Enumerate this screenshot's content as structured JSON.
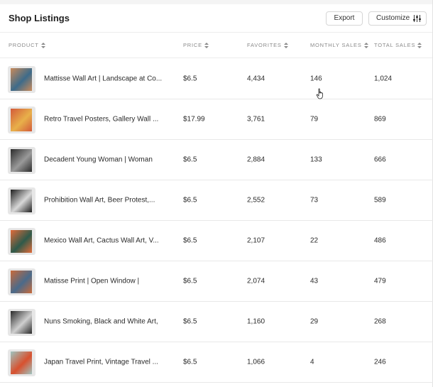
{
  "header": {
    "title": "Shop Listings",
    "export_label": "Export",
    "customize_label": "Customize"
  },
  "columns": {
    "product": "PRODUCT",
    "price": "PRICE",
    "favorites": "FAVORITES",
    "monthly_sales": "MONTHLY SALES",
    "total_sales": "TOTAL SALES"
  },
  "rows": [
    {
      "name": "Mattisse Wall Art | Landscape at Co...",
      "price": "$6.5",
      "favorites": "4,434",
      "monthly_sales": "146",
      "total_sales": "1,024",
      "thumb_color": "#c98a5a",
      "thumb_accent": "#3d6b8a"
    },
    {
      "name": "Retro Travel Posters, Gallery Wall ...",
      "price": "$17.99",
      "favorites": "3,761",
      "monthly_sales": "79",
      "total_sales": "869",
      "thumb_color": "#d35a3a",
      "thumb_accent": "#e8b04a"
    },
    {
      "name": "Decadent Young Woman | Woman",
      "price": "$6.5",
      "favorites": "2,884",
      "monthly_sales": "133",
      "total_sales": "666",
      "thumb_color": "#2b2b2b",
      "thumb_accent": "#9a9a9a"
    },
    {
      "name": "Prohibition Wall Art, Beer Protest,...",
      "price": "$6.5",
      "favorites": "2,552",
      "monthly_sales": "73",
      "total_sales": "589",
      "thumb_color": "#1f1f1f",
      "thumb_accent": "#d8d8d8"
    },
    {
      "name": "Mexico Wall Art, Cactus Wall Art, V...",
      "price": "$6.5",
      "favorites": "2,107",
      "monthly_sales": "22",
      "total_sales": "486",
      "thumb_color": "#e26b3a",
      "thumb_accent": "#2e5a4a"
    },
    {
      "name": "Matisse Print | Open Window |",
      "price": "$6.5",
      "favorites": "2,074",
      "monthly_sales": "43",
      "total_sales": "479",
      "thumb_color": "#c96a3a",
      "thumb_accent": "#4a6a8a"
    },
    {
      "name": "Nuns Smoking, Black and White Art,",
      "price": "$6.5",
      "favorites": "1,160",
      "monthly_sales": "29",
      "total_sales": "268",
      "thumb_color": "#2a2a2a",
      "thumb_accent": "#cfcfcf"
    },
    {
      "name": "Japan Travel Print, Vintage Travel ...",
      "price": "$6.5",
      "favorites": "1,066",
      "monthly_sales": "4",
      "total_sales": "246",
      "thumb_color": "#9ec4c0",
      "thumb_accent": "#d8502e"
    }
  ]
}
